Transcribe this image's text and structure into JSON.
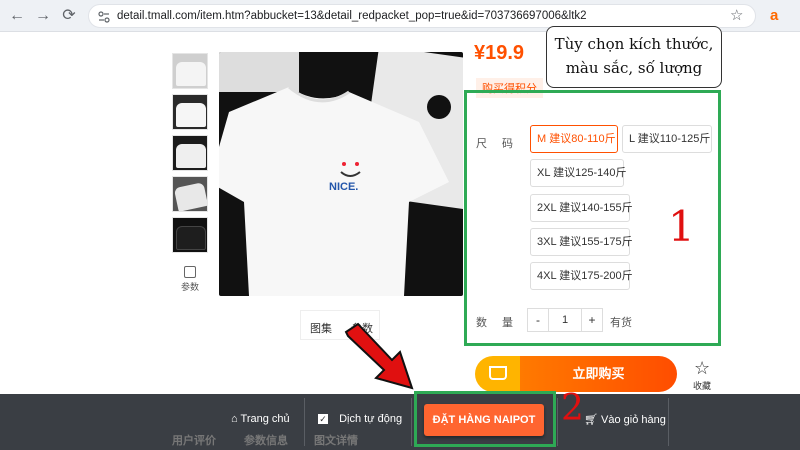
{
  "browser": {
    "url": "detail.tmall.com/item.htm?abbucket=13&detail_redpacket_pop=true&id=703736697006&ltk2",
    "ext_label": "a"
  },
  "product": {
    "price": "¥19.9",
    "buy_note": "购买得积分",
    "params_label": "参数",
    "gallery_tab": "图集",
    "params_tab": "参数"
  },
  "tooltip": {
    "line1": "Tùy chọn kích thước,",
    "line2": "màu sắc, số lượng"
  },
  "options": {
    "size_label": "尺　码",
    "sizes": [
      "M 建议80-110斤",
      "L 建议110-125斤",
      "XL 建议125-140斤",
      "2XL 建议140-155斤",
      "3XL 建议155-175斤",
      "4XL 建议175-200斤"
    ],
    "selected_size": "M 建议80-110斤",
    "qty_label": "数　量",
    "qty_minus": "-",
    "qty_value": "1",
    "qty_plus": "+",
    "stock": "有货"
  },
  "annotations": {
    "mark1": "1",
    "mark2": "2",
    "highlight_color": "#2eaa55",
    "arrow_color": "#e01010"
  },
  "actions": {
    "buy_now": "立即购买",
    "favorite": "收藏"
  },
  "bottom_bar": {
    "home": "Trang chủ",
    "auto_translate": "Dịch tự động",
    "naipot_order": "ĐẶT HÀNG NAIPOT",
    "cart": "Vào giỏ hàng",
    "under_tabs": [
      "用户评价",
      "参数信息",
      "图文详情"
    ]
  },
  "colors": {
    "accent": "#ff5000",
    "bar_bg": "#3a3e44",
    "naipot_btn": "#ff6530"
  }
}
